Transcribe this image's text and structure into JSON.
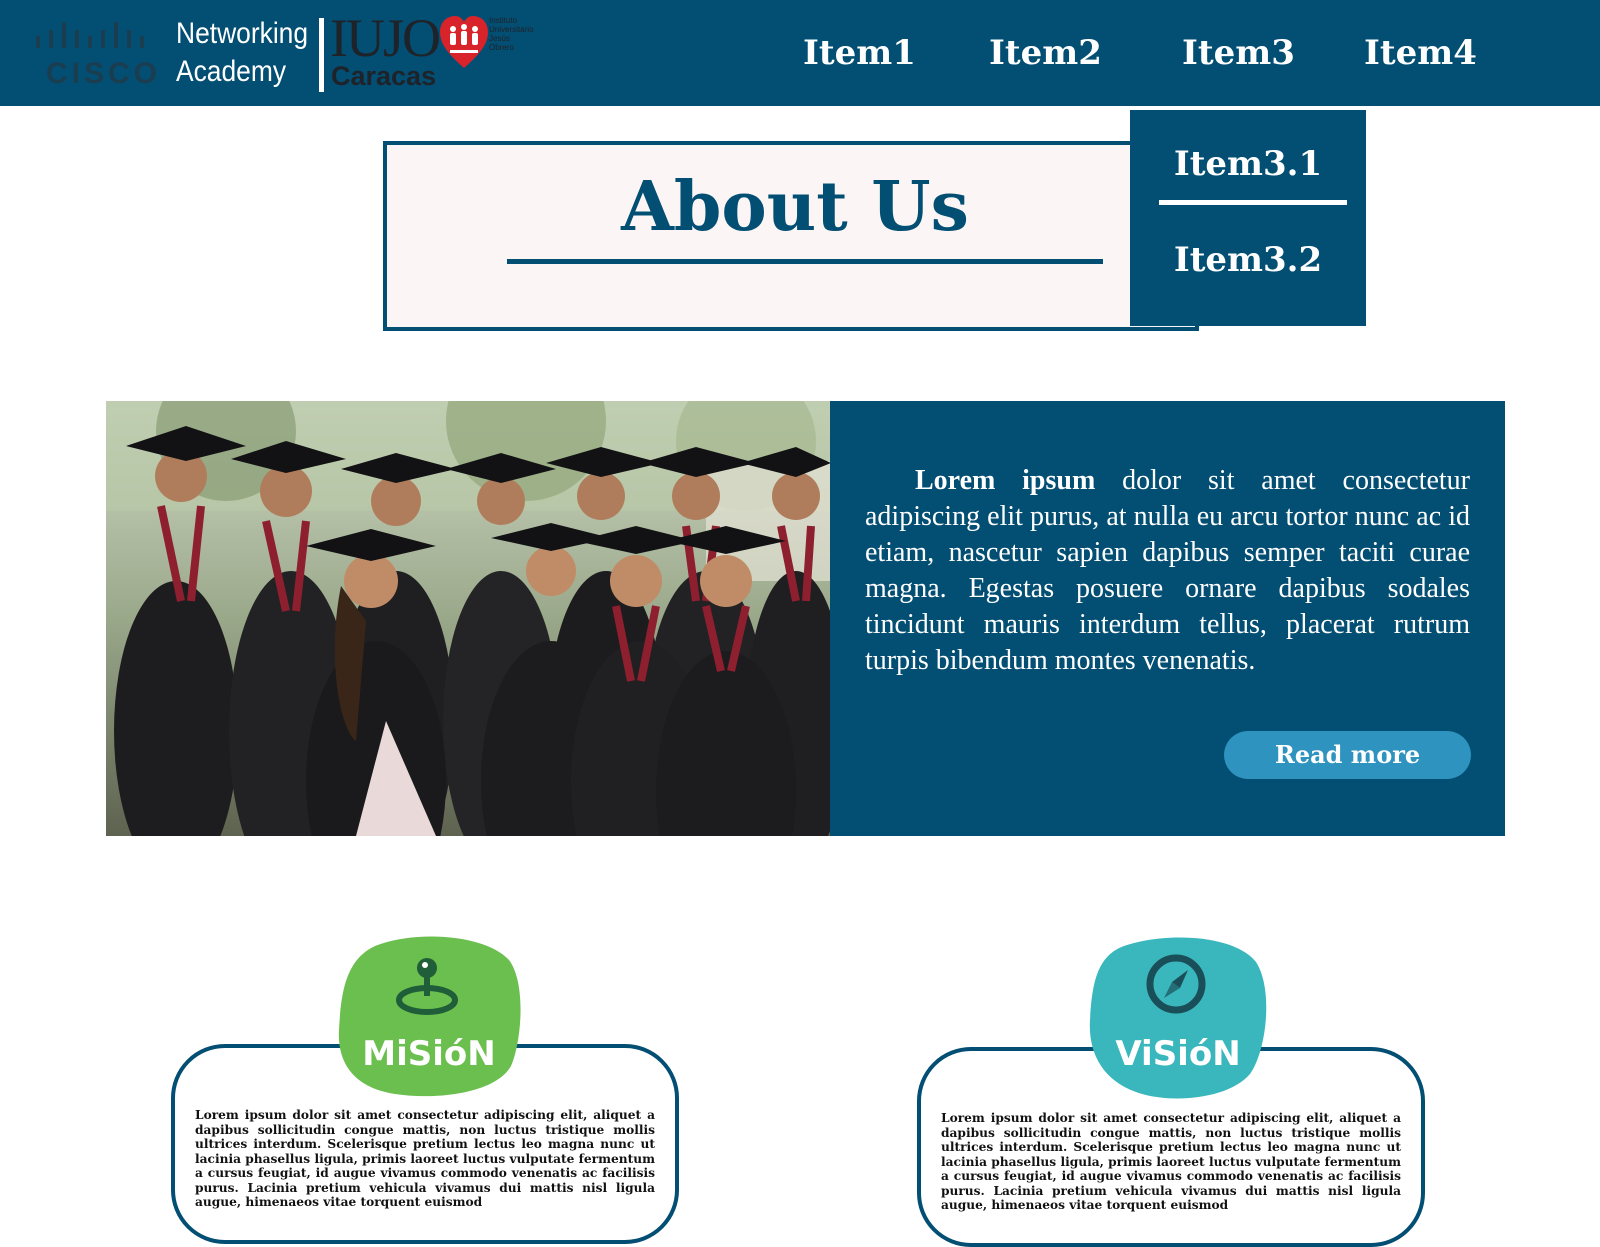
{
  "header": {
    "cisco_wordmark": "CISCO",
    "networking_line1": "Networking",
    "networking_line2": "Academy",
    "iujo_wordmark": "IUJO",
    "iujo_city": "Caracas",
    "institute_text": [
      "Instituto",
      "Universitario",
      "Jesús",
      "Obrero"
    ]
  },
  "nav": {
    "items": [
      {
        "label": "Item1"
      },
      {
        "label": "Item2"
      },
      {
        "label": "Item3"
      },
      {
        "label": "Item4"
      }
    ],
    "dropdown": [
      {
        "label": "Item3.1"
      },
      {
        "label": "Item3.2"
      }
    ]
  },
  "about": {
    "title": "About Us"
  },
  "hero": {
    "text_bold": "Lorem ipsum",
    "text": " dolor sit amet consectetur adipiscing elit purus, at nulla eu arcu tortor nunc ac id etiam, nascetur sapien dapibus semper taciti curae magna. Egestas posuere ornare dapibus sodales tincidunt mauris interdum tellus, placerat rutrum turpis bibendum montes venenatis.",
    "button": "Read more"
  },
  "mision": {
    "label": "MiSióN",
    "text": "Lorem ipsum dolor sit amet consectetur adipiscing elit, aliquet a dapibus sollicitudin congue mattis, non luctus tristique mollis ultrices interdum. Scelerisque pretium lectus leo magna nunc ut lacinia phasellus ligula, primis laoreet luctus vulputate fermentum a cursus feugiat, id augue vivamus commodo venenatis ac facilisis purus. Lacinia pretium vehicula vivamus dui mattis nisl ligula augue, himenaeos vitae torquent euismod"
  },
  "vision": {
    "label": "ViSióN",
    "text": "Lorem ipsum dolor sit amet consectetur adipiscing elit, aliquet a dapibus sollicitudin congue mattis, non luctus tristique mollis ultrices interdum. Scelerisque pretium lectus leo magna nunc ut lacinia phasellus ligula, primis laoreet luctus vulputate fermentum a cursus feugiat, id augue vivamus commodo venenatis ac facilisis purus. Lacinia pretium vehicula vivamus dui mattis nisl ligula augue, himenaeos vitae torquent euismod"
  },
  "colors": {
    "brand_blue": "#034e73",
    "button_blue": "#2e93be",
    "mision_green": "#6bbf4e",
    "vision_teal": "#3ab7bd",
    "heart_red": "#d8232a"
  },
  "icons": {
    "mision": "joystick-pin-icon",
    "vision": "compass-icon"
  }
}
